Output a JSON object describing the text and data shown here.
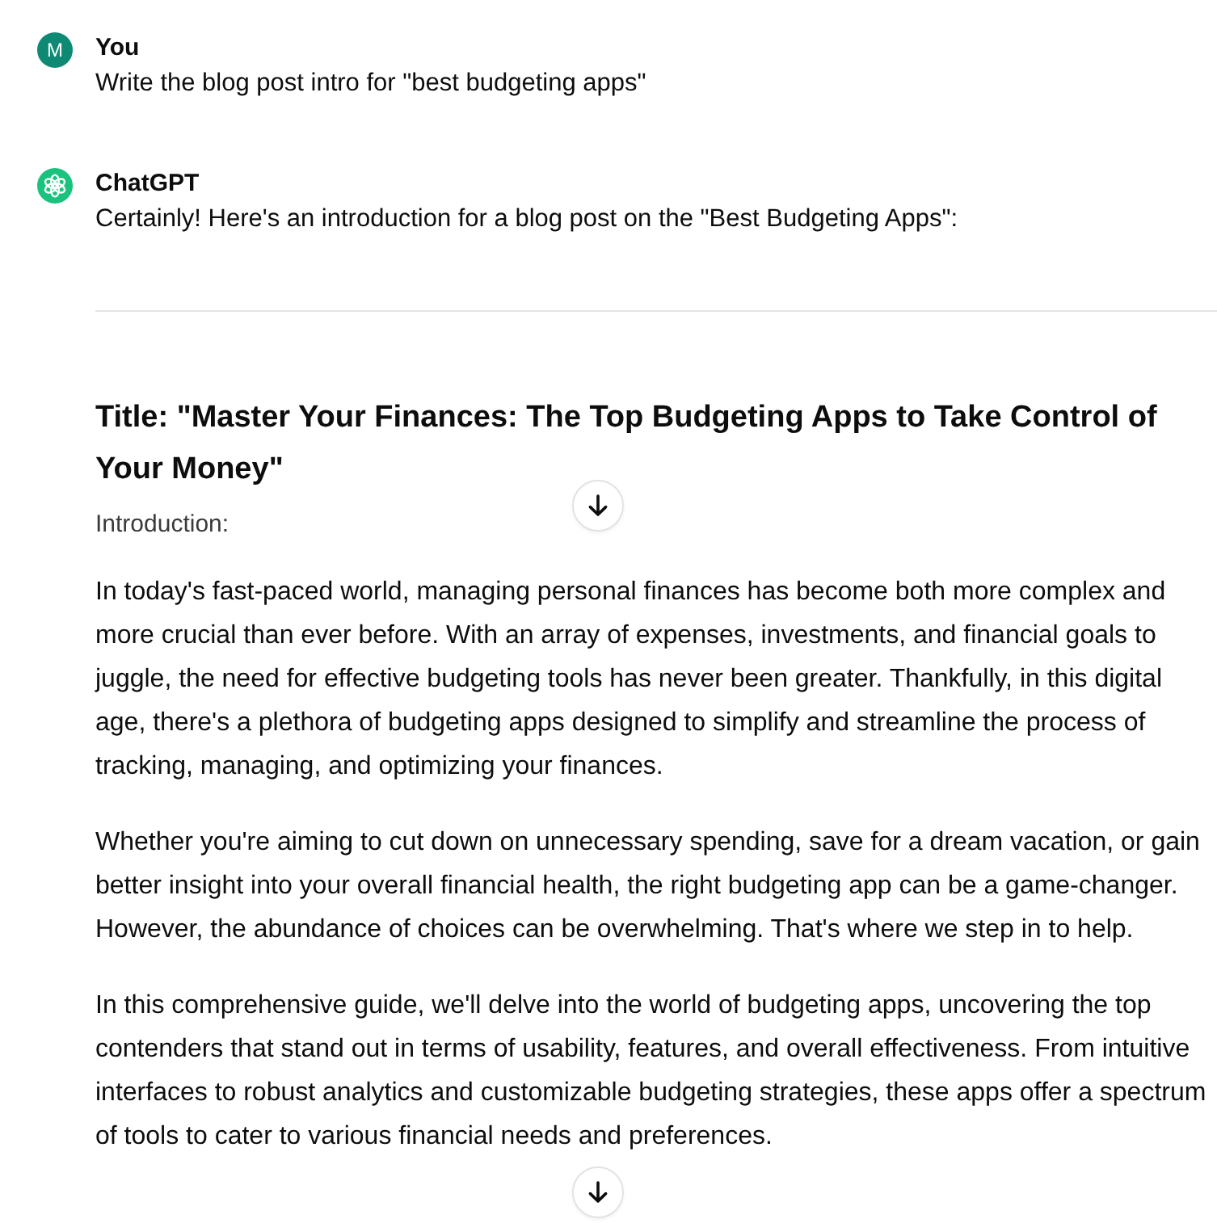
{
  "messages": [
    {
      "author": "You",
      "avatar": {
        "kind": "initial",
        "initial": "M"
      },
      "blocks": [
        {
          "kind": "text",
          "text": "Write the blog post intro for \"best budgeting apps\""
        }
      ]
    },
    {
      "author": "ChatGPT",
      "avatar": {
        "kind": "logo"
      },
      "blocks": [
        {
          "kind": "text",
          "text": "Certainly! Here's an introduction for a blog post on the \"Best Budgeting Apps\":"
        },
        {
          "kind": "divider"
        },
        {
          "kind": "heading",
          "text": "Title: \"Master Your Finances: The Top Budgeting Apps to Take Control of Your Money\""
        },
        {
          "kind": "label",
          "text": "Introduction:"
        },
        {
          "kind": "paragraph",
          "text": "In today's fast-paced world, managing personal finances has become both more complex and more crucial than ever before. With an array of expenses, investments, and financial goals to juggle, the need for effective budgeting tools has never been greater. Thankfully, in this digital age, there's a plethora of budgeting apps designed to simplify and streamline the process of tracking, managing, and optimizing your finances."
        },
        {
          "kind": "paragraph",
          "text": "Whether you're aiming to cut down on unnecessary spending, save for a dream vacation, or gain better insight into your overall financial health, the right budgeting app can be a game-changer. However, the abundance of choices can be overwhelming. That's where we step in to help."
        },
        {
          "kind": "paragraph",
          "text": "In this comprehensive guide, we'll delve into the world of budgeting apps, uncovering the top contenders that stand out in terms of usability, features, and overall effectiveness. From intuitive interfaces to robust analytics and customizable budgeting strategies, these apps offer a spectrum of tools to cater to various financial needs and preferences."
        }
      ]
    }
  ]
}
